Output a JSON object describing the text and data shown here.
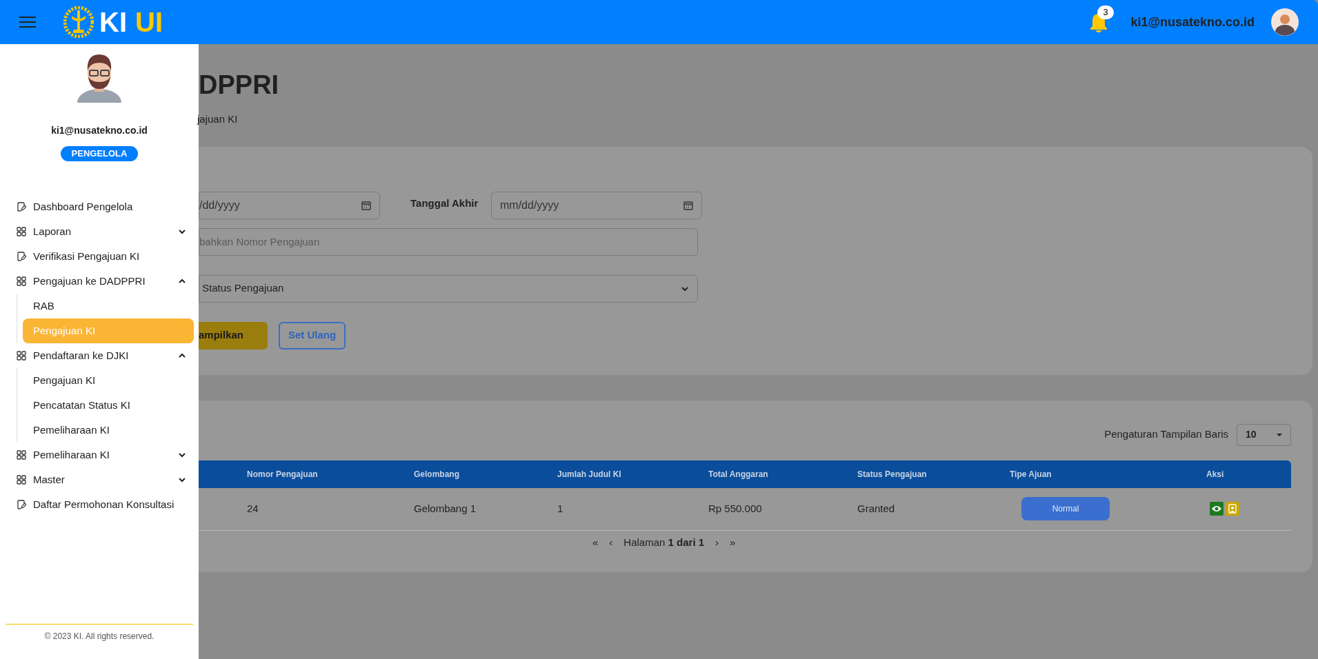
{
  "topbar": {
    "brand": {
      "primary": "KI",
      "accent": "UI"
    },
    "notification_count": "3",
    "user_email": "ki1@nusatekno.co.id"
  },
  "sidebar": {
    "user": {
      "email": "ki1@nusatekno.co.id",
      "role": "PENGELOLA"
    },
    "items": [
      {
        "kind": "page",
        "label": "Dashboard Pengelola"
      },
      {
        "kind": "group",
        "label": "Laporan",
        "expanded": false
      },
      {
        "kind": "page",
        "label": "Verifikasi Pengajuan KI"
      },
      {
        "kind": "group",
        "label": "Pengajuan ke DADPPRI",
        "expanded": true,
        "children": [
          {
            "label": "RAB",
            "selected": false
          },
          {
            "label": "Pengajuan KI",
            "selected": true
          }
        ]
      },
      {
        "kind": "group",
        "label": "Pendaftaran ke DJKI",
        "expanded": true,
        "children": [
          {
            "label": "Pengajuan KI",
            "selected": false
          },
          {
            "label": "Pencatatan Status KI",
            "selected": false
          },
          {
            "label": "Pemeliharaan KI",
            "selected": false
          }
        ]
      },
      {
        "kind": "group",
        "label": "Pemeliharaan KI",
        "expanded": false
      },
      {
        "kind": "group",
        "label": "Master",
        "expanded": false
      },
      {
        "kind": "page",
        "label": "Daftar Permohonan Konsultasi"
      }
    ],
    "footer": "© 2023 KI. All rights reserved."
  },
  "main": {
    "title": "DPPRI",
    "breadcrumb": "jajuan KI",
    "filter": {
      "start_date": {
        "placeholder": "/dd/yyyy"
      },
      "end_label": "Tanggal Akhir",
      "end_date": {
        "placeholder": "mm/dd/yyyy"
      },
      "search": {
        "placeholder": "bahkan Nomor Pengajuan"
      },
      "status_select": {
        "value": "Status Pengajuan"
      },
      "buttons": [
        {
          "kind": "primary",
          "label": "ampilkan"
        },
        {
          "kind": "outline",
          "label": "Set Ulang"
        }
      ]
    },
    "table": {
      "rows_setting": {
        "label": "Pengaturan Tampilan Baris",
        "value": "10"
      },
      "columns": [
        "Nomor Pengajuan",
        "Gelombang",
        "Jumlah Judul KI",
        "Total Anggaran",
        "Status Pengajuan",
        "Tipe Ajuan",
        "Aksi"
      ],
      "rows": [
        {
          "cells": [
            "24",
            "Gelombang 1",
            "1",
            "Rp 550.000",
            "Granted"
          ],
          "type": "Normal",
          "actions": [
            {
              "kind": "view"
            },
            {
              "kind": "user"
            }
          ]
        }
      ],
      "pagination": {
        "first": "«",
        "prev": "‹",
        "text": "Halaman **1 dari 1**",
        "next": "›",
        "last": "»"
      }
    }
  }
}
